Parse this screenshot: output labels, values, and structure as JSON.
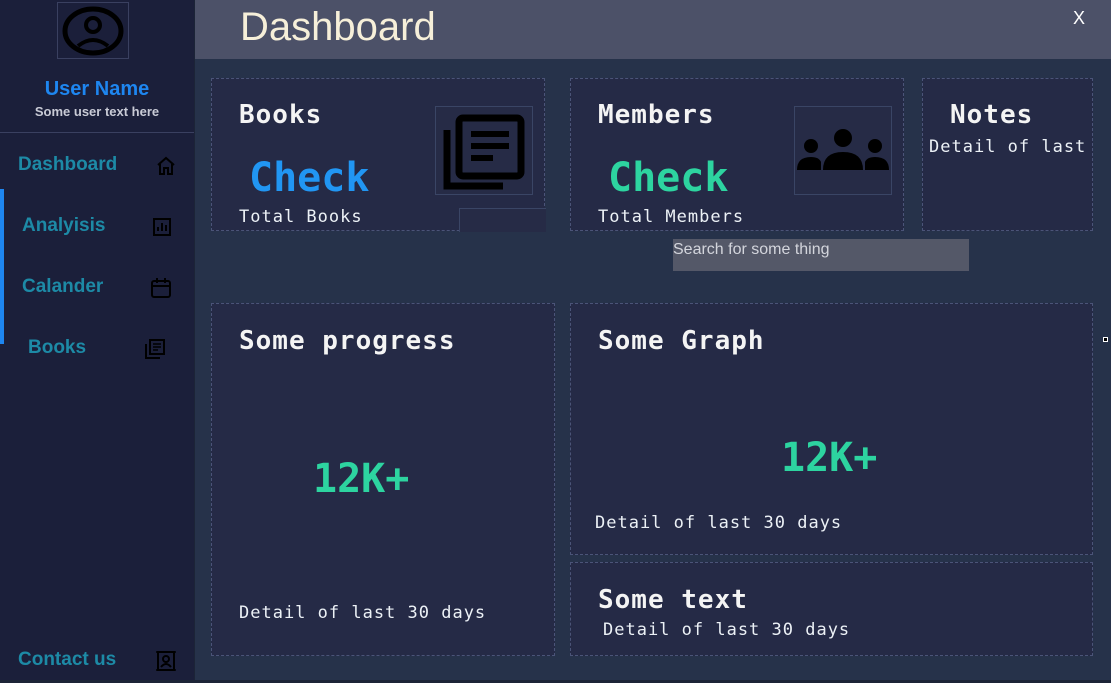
{
  "sidebar": {
    "user_name": "User Name",
    "user_text": "Some user text here",
    "items": [
      {
        "label": "Dashboard",
        "icon": "home-icon"
      },
      {
        "label": "Analyisis",
        "icon": "chart-icon"
      },
      {
        "label": "Calander",
        "icon": "calendar-icon"
      },
      {
        "label": "Books",
        "icon": "books-icon"
      }
    ],
    "contact_label": "Contact us"
  },
  "header": {
    "title": "Dashboard",
    "close_label": "X"
  },
  "search": {
    "placeholder": "Search for some thing"
  },
  "cards": {
    "books": {
      "title": "Books",
      "value": "Check",
      "subtitle": "Total Books"
    },
    "members": {
      "title": "Members",
      "value": "Check",
      "subtitle": "Total Members"
    },
    "notes": {
      "title": "Notes",
      "subtitle": "Detail of last"
    },
    "progress": {
      "title": "Some progress",
      "value": "12K+",
      "subtitle": "Detail of last 30 days"
    },
    "graph": {
      "title": "Some Graph",
      "value": "12K+",
      "subtitle": "Detail of last 30 days"
    },
    "text": {
      "title": "Some text",
      "subtitle": "Detail of last 30 days"
    }
  },
  "colors": {
    "accent": "#1e86f0",
    "teal": "#2dd4a0",
    "nav": "#1d8aa6",
    "blue_value": "#2196f3"
  }
}
